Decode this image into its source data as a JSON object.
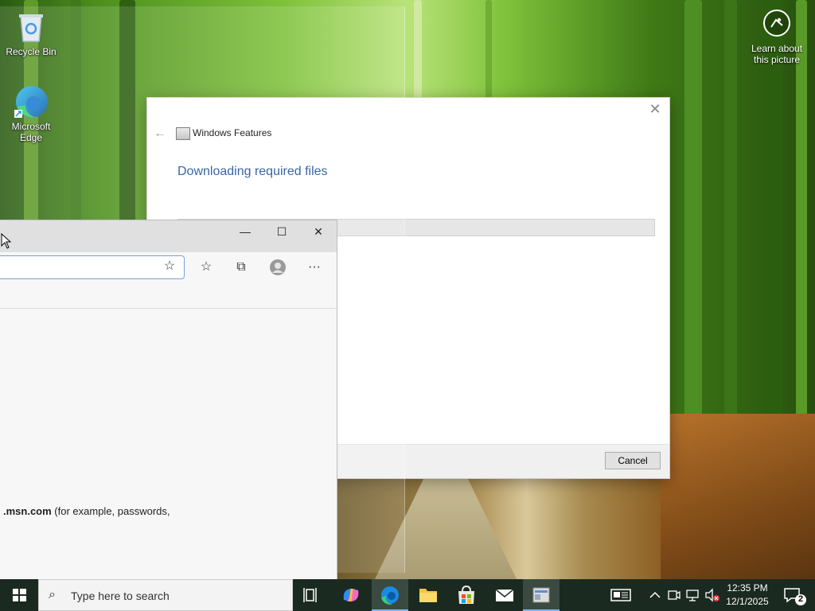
{
  "desktop": {
    "icons": [
      {
        "label": "Recycle Bin"
      },
      {
        "label": "Microsoft Edge"
      }
    ],
    "learn_about": "Learn about this picture"
  },
  "windows_features": {
    "title": "Windows Features",
    "heading": "Downloading required files",
    "progress": 0.05,
    "cancel_label": "Cancel",
    "close_glyph": "✕",
    "back_glyph": "←"
  },
  "edge": {
    "window_buttons": {
      "minimize": "—",
      "maximize": "☐",
      "close": "✕"
    },
    "toolbar": {
      "add_favorite": "☆",
      "favorites": "☆",
      "collections": "⧉",
      "more": "···"
    },
    "message_bold": ".msn.com",
    "message_rest": " (for example, passwords,"
  },
  "taskbar": {
    "search_placeholder": "Type here to search",
    "time": "12:35 PM",
    "date": "12/1/2025",
    "notification_count": "2"
  },
  "colors": {
    "accent": "#1a4f9a",
    "progress_fill": "#06b025",
    "taskbar": "#1b2a20"
  }
}
